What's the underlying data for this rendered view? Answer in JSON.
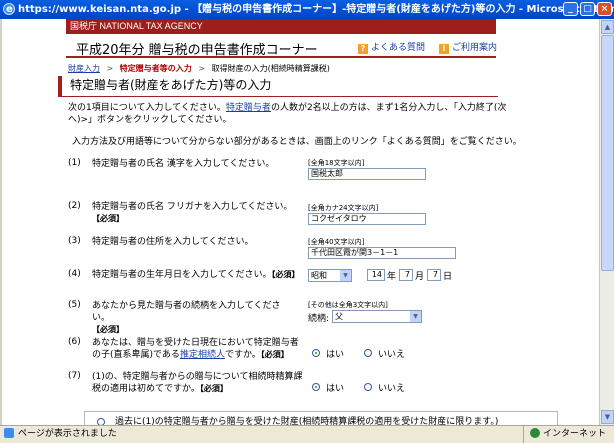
{
  "window": {
    "title": "https://www.keisan.nta.go.jp - 【贈与税の申告書作成コーナー】-特定贈与者(財産をあげた方)等の入力 - Microsoft Internet Explorer",
    "status_text": "ページが表示されました",
    "zone": "インターネット"
  },
  "header": {
    "brand": "国税庁  NATIONAL TAX AGENCY",
    "app_title": "平成20年分 贈与税の申告書作成コーナー",
    "faq_link": "よくある質問",
    "guide_link": "ご利用案内"
  },
  "breadcrumb": {
    "item1": "財産入力",
    "item2": "特定贈与者等の入力",
    "item3": "取得財産の入力(相続時精算課税)",
    "sep": ">"
  },
  "section_title": "特定贈与者(財産をあげた方)等の入力",
  "intro": {
    "line1_pre": "次の1項目について入力してください。",
    "line1_link": "特定贈与者",
    "line1_post": "の人数が2名以上の方は、まず1名分入力し、「入力終了(次へ)>」ボタンをクリックしてください。",
    "line2": "入力方法及び用語等について分からない部分があるときは、画面上のリンク「よくある質問」をご覧ください。"
  },
  "q1": {
    "num": "(1)",
    "text": "特定贈与者の氏名 漢字を入力してください。",
    "hint": "[全角18文字以内]",
    "value": "国税太郎"
  },
  "q2": {
    "num": "(2)",
    "text": "特定贈与者の氏名 フリガナを入力してください。",
    "req": "【必須】",
    "hint": "[全角カナ24文字以内]",
    "value": "コクゼイタロウ"
  },
  "q3": {
    "num": "(3)",
    "text": "特定贈与者の住所を入力してください。",
    "hint": "[全角40文字以内]",
    "value": "千代田区霞が関3－1－1"
  },
  "q4": {
    "num": "(4)",
    "text": "特定贈与者の生年月日を入力してください。",
    "req": "【必須】",
    "era": "昭和",
    "year": "14",
    "year_unit": "年",
    "month": "7",
    "month_unit": "月",
    "day": "7",
    "day_unit": "日"
  },
  "q5": {
    "num": "(5)",
    "text": "あなたから見た贈与者の続柄を入力してください。",
    "req": "【必須】",
    "hint": "[その他は全角3文字以内]",
    "label": "続柄:",
    "value": "父"
  },
  "q6": {
    "num": "(6)",
    "text_pre": "あなたは、贈与を受けた日現在において特定贈与者の子(直系卑属)である",
    "text_link": "推定相続人",
    "text_post": "ですか。",
    "req": "【必須】",
    "yes": "はい",
    "no": "いいえ"
  },
  "q7": {
    "num": "(7)",
    "text": "(1)の、特定贈与者からの贈与について相続時精算課税の適用は初めてですか。",
    "req": "【必須】",
    "yes": "はい",
    "no": "いいえ"
  },
  "last_option": "過去に(1)の特定贈与者から贈与を受けた財産(相続時精算課税の適用を受けた財産に限ります。)"
}
